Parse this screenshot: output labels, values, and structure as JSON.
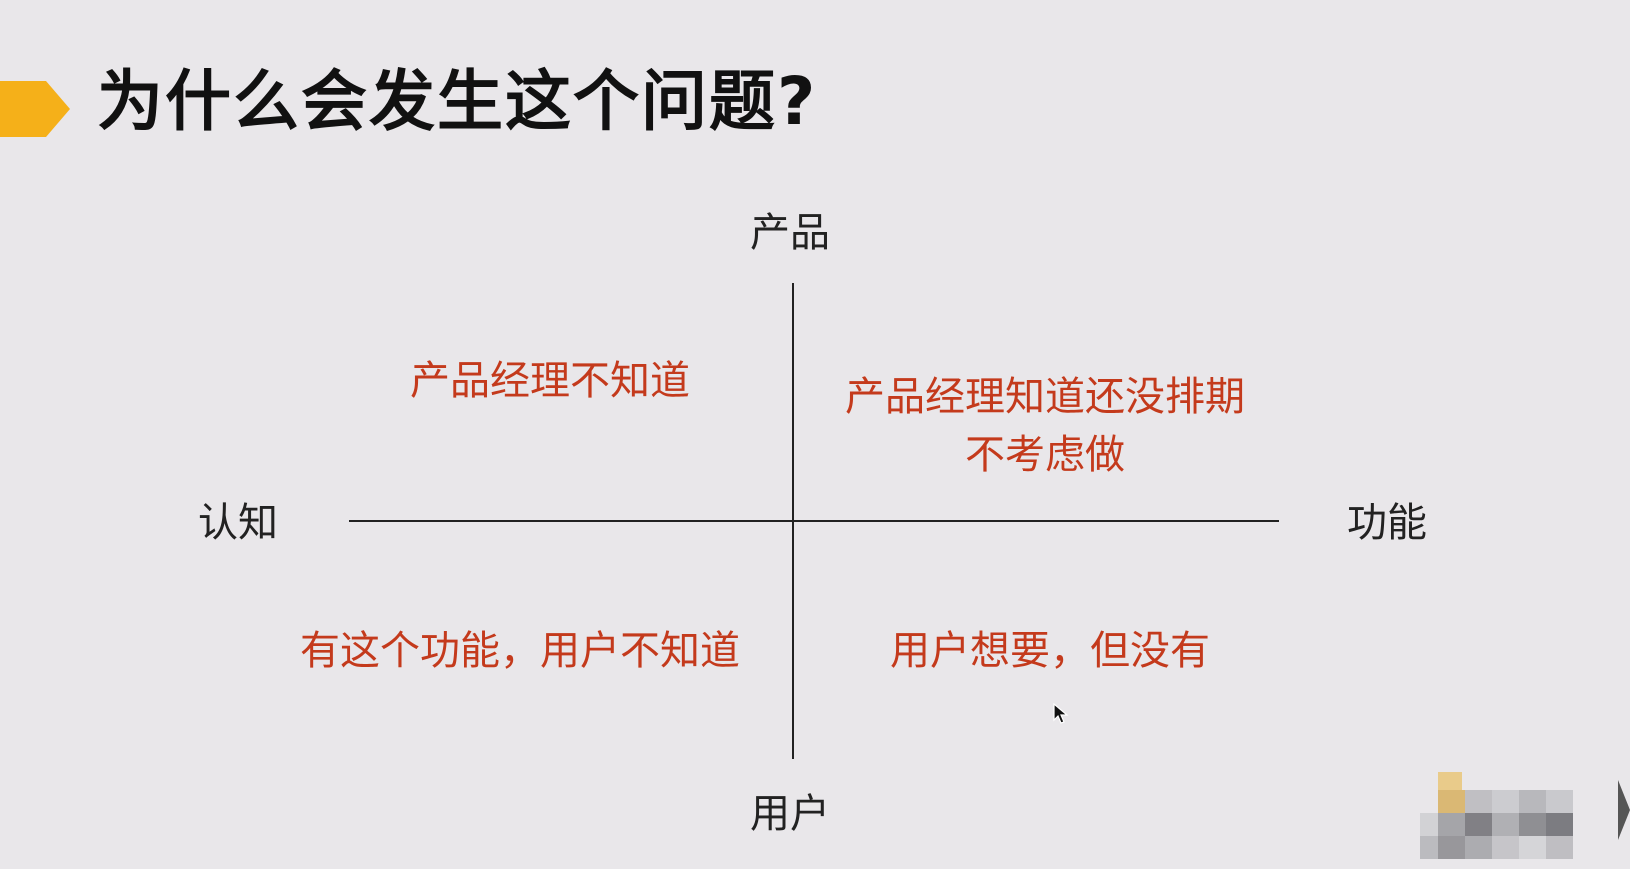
{
  "slide": {
    "title": "为什么会发生这个问题?",
    "accent_color": "#f5b019"
  },
  "diagram": {
    "axes": {
      "top": "产品",
      "bottom": "用户",
      "left": "认知",
      "right": "功能"
    },
    "quadrants": {
      "top_left": [
        "产品经理不知道"
      ],
      "top_right": [
        "产品经理知道还没排期",
        "不考虑做"
      ],
      "bottom_left": [
        "有这个功能，用户不知道"
      ],
      "bottom_right": [
        "用户想要，但没有"
      ]
    },
    "quadrant_text_color": "#c43a1c"
  },
  "icons": {
    "cursor": "mouse-pointer-icon",
    "title_marker": "pentagon-arrow-icon"
  }
}
